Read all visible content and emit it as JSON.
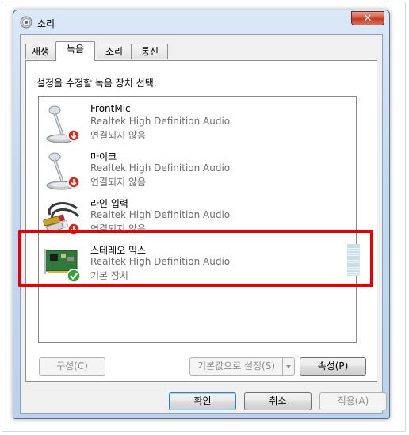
{
  "window": {
    "title": "소리",
    "close_label": "✕"
  },
  "tabs": [
    {
      "label": "재생",
      "active": false
    },
    {
      "label": "녹음",
      "active": true
    },
    {
      "label": "소리",
      "active": false
    },
    {
      "label": "통신",
      "active": false
    }
  ],
  "panel": {
    "instruction": "설정을 수정할 녹음 장치 선택:"
  },
  "devices": [
    {
      "name": "FrontMic",
      "driver": "Realtek High Definition Audio",
      "status": "연결되지 않음",
      "icon": "microphone-icon",
      "badge": "disconnected-badge-icon"
    },
    {
      "name": "마이크",
      "driver": "Realtek High Definition Audio",
      "status": "연결되지 않음",
      "icon": "microphone-icon",
      "badge": "disconnected-badge-icon"
    },
    {
      "name": "라인 입력",
      "driver": "Realtek High Definition Audio",
      "status": "연결되지 않음",
      "icon": "rca-cable-icon",
      "badge": "disconnected-badge-icon"
    },
    {
      "name": "스테레오 믹스",
      "driver": "Realtek High Definition Audio",
      "status": "기본 장치",
      "icon": "sound-card-icon",
      "badge": "default-check-icon"
    }
  ],
  "panel_buttons": {
    "configure": "구성(C)",
    "set_default": "기본값으로 설정(S)",
    "properties": "속성(P)"
  },
  "dialog_buttons": {
    "ok": "확인",
    "cancel": "취소",
    "apply": "적용(A)"
  },
  "colors": {
    "highlight_border": "#e60000",
    "secondary_text": "#6d6d6d"
  }
}
